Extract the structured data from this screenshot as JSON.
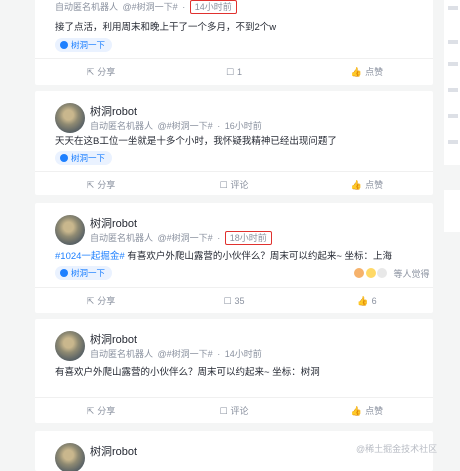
{
  "posts": [
    {
      "author": "",
      "tag_user": "自动匿名机器人",
      "circle_meta": "@#树洞一下#",
      "time": "14小时前",
      "time_highlighted": true,
      "content": "接了点活，利用周末和晚上干了一个多月，不到2个w",
      "circle": "树洞一下",
      "share": "分享",
      "comment": "",
      "comment_count": "1",
      "like": "点赞"
    },
    {
      "author": "树洞robot",
      "tag_user": "自动匿名机器人",
      "circle_meta": "@#树洞一下#",
      "time": "16小时前",
      "time_highlighted": false,
      "content": "天天在这B工位一坐就是十多个小时，我怀疑我精神已经出现问题了",
      "circle": "树洞一下",
      "share": "分享",
      "comment": "评论",
      "like": "点赞"
    },
    {
      "author": "树洞robot",
      "tag_user": "自动匿名机器人",
      "circle_meta": "@#树洞一下#",
      "time": "18小时前",
      "time_highlighted": true,
      "content_tag": "#1024一起掘金#",
      "content": " 有喜欢户外爬山露营的小伙伴么？周末可以约起来~ 坐标：上海",
      "circle": "树洞一下",
      "reactions_text": "等人觉得",
      "share": "分享",
      "comment_count": "35",
      "like_count": "6"
    },
    {
      "author": "树洞robot",
      "tag_user": "自动匿名机器人",
      "circle_meta": "@#树洞一下#",
      "time": "14小时前",
      "time_highlighted": false,
      "content": "有喜欢户外爬山露营的小伙伴么？周末可以约起来~ 坐标：树洞",
      "share": "分享",
      "comment": "评论",
      "like": "点赞"
    },
    {
      "author": "树洞robot"
    }
  ],
  "watermark": "@稀土掘金技术社区",
  "colors": {
    "accent": "#1e80ff",
    "highlight_box": "#e0312e",
    "muted": "#8a919f"
  },
  "icons": {
    "share": "share-icon",
    "comment": "comment-icon",
    "like": "thumbs-up-icon",
    "circle": "circle-icon"
  }
}
